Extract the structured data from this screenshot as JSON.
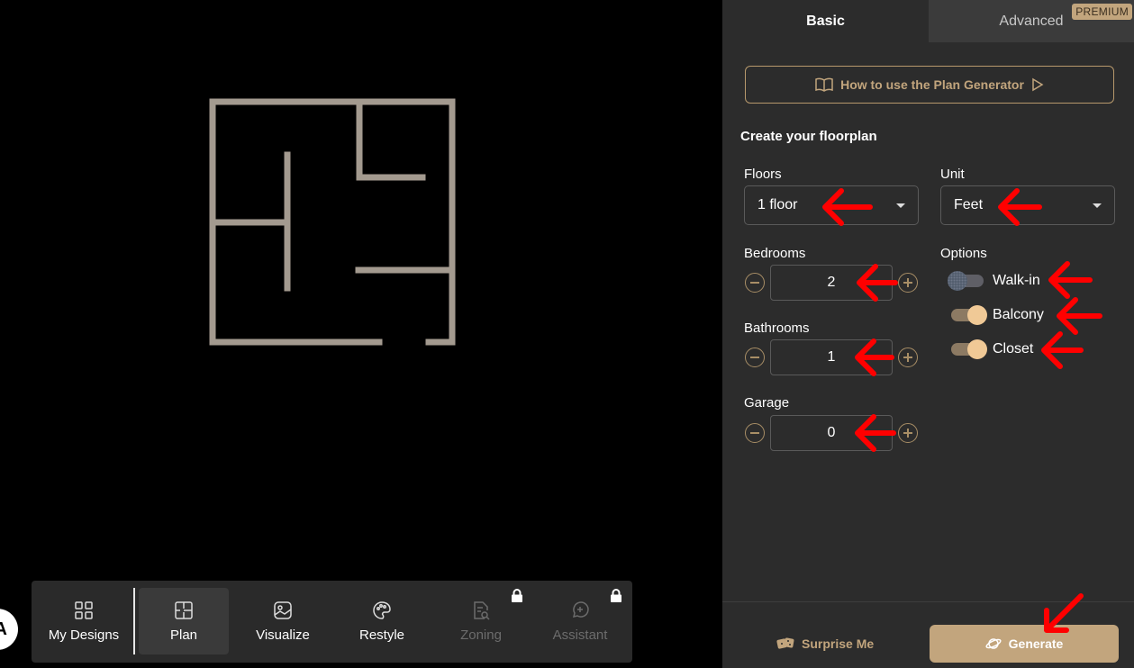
{
  "toolbar": {
    "items": [
      {
        "label": "My Designs",
        "icon": "grid-icon",
        "state": "normal"
      },
      {
        "label": "Plan",
        "icon": "floorplan-icon",
        "state": "active"
      },
      {
        "label": "Visualize",
        "icon": "image-icon",
        "state": "normal"
      },
      {
        "label": "Restyle",
        "icon": "palette-icon",
        "state": "normal"
      },
      {
        "label": "Zoning",
        "icon": "document-search-icon",
        "state": "locked"
      },
      {
        "label": "Assistant",
        "icon": "chat-icon",
        "state": "locked"
      }
    ]
  },
  "avatar": {
    "initial": "A"
  },
  "panel": {
    "tabs": {
      "basic": "Basic",
      "advanced": "Advanced",
      "premium_badge": "PREMIUM"
    },
    "howto_label": "How to use the Plan Generator",
    "section_title": "Create your floorplan",
    "floors": {
      "label": "Floors",
      "value": "1 floor"
    },
    "unit": {
      "label": "Unit",
      "value": "Feet"
    },
    "bedrooms": {
      "label": "Bedrooms",
      "value": "2"
    },
    "bathrooms": {
      "label": "Bathrooms",
      "value": "1"
    },
    "garage": {
      "label": "Garage",
      "value": "0"
    },
    "options": {
      "label": "Options",
      "walkin": {
        "label": "Walk-in",
        "enabled": false
      },
      "balcony": {
        "label": "Balcony",
        "enabled": true
      },
      "closet": {
        "label": "Closet",
        "enabled": true
      }
    },
    "surprise_label": "Surprise Me",
    "generate_label": "Generate"
  },
  "colors": {
    "accent": "#c2a57d",
    "wall": "#a39a8f",
    "annotation": "#ff0000"
  }
}
